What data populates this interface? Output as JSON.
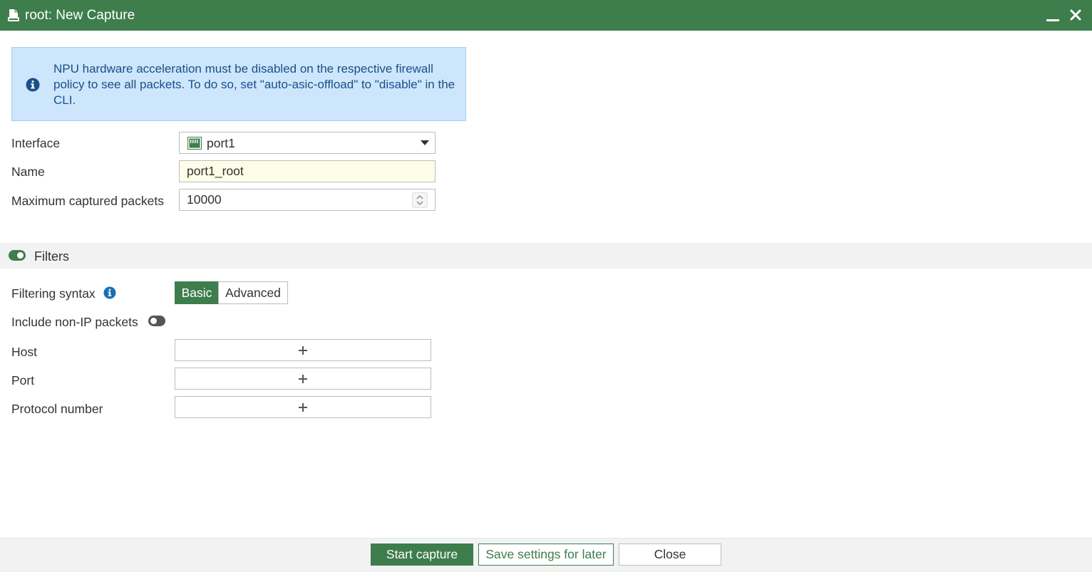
{
  "window": {
    "title": "root: New Capture"
  },
  "notice": {
    "text": "NPU hardware acceleration must be disabled on the respective firewall policy to see all packets. To do so, set \"auto-asic-offload\" to \"disable\" in the CLI."
  },
  "form": {
    "interface_label": "Interface",
    "interface_value": "port1",
    "name_label": "Name",
    "name_value": "port1_root",
    "max_packets_label": "Maximum captured packets",
    "max_packets_value": "10000"
  },
  "filters": {
    "section_title": "Filters",
    "enabled": true,
    "syntax_label": "Filtering syntax",
    "syntax_options": [
      "Basic",
      "Advanced"
    ],
    "syntax_selected": "Basic",
    "non_ip_label": "Include non-IP packets",
    "non_ip_enabled": false,
    "host_label": "Host",
    "port_label": "Port",
    "protocol_label": "Protocol number"
  },
  "footer": {
    "start_label": "Start capture",
    "save_label": "Save settings for later",
    "close_label": "Close"
  },
  "colors": {
    "brand_green": "#3e7d4c",
    "notice_bg": "#cde6fb",
    "notice_text": "#1a4f8a",
    "name_field_bg": "#fdfde8"
  }
}
